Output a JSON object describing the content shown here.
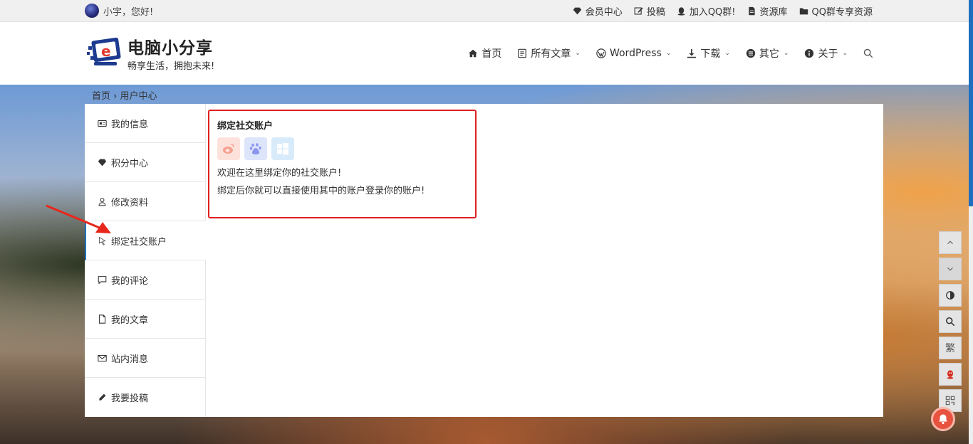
{
  "topbar": {
    "greeting": "小宇，您好!",
    "links": [
      {
        "label": "会员中心",
        "icon": "diamond-icon"
      },
      {
        "label": "投稿",
        "icon": "edit-icon"
      },
      {
        "label": "加入QQ群!",
        "icon": "qq-icon"
      },
      {
        "label": "资源库",
        "icon": "file-icon"
      },
      {
        "label": "QQ群专享资源",
        "icon": "folder-icon"
      }
    ]
  },
  "header": {
    "site_name": "电脑小分享",
    "slogan": "畅享生活，拥抱未来!",
    "nav": [
      {
        "label": "首页",
        "icon": "home-icon",
        "dropdown": false
      },
      {
        "label": "所有文章",
        "icon": "list-icon",
        "dropdown": true
      },
      {
        "label": "WordPress",
        "icon": "wordpress-icon",
        "dropdown": true
      },
      {
        "label": "下载",
        "icon": "download-icon",
        "dropdown": true
      },
      {
        "label": "其它",
        "icon": "circle-list-icon",
        "dropdown": true
      },
      {
        "label": "关于",
        "icon": "info-icon",
        "dropdown": true
      }
    ],
    "search_icon": "search-icon"
  },
  "breadcrumb": "首页 › 用户中心",
  "sidebar": {
    "items": [
      {
        "label": "我的信息",
        "icon": "id-card-icon",
        "active": false
      },
      {
        "label": "积分中心",
        "icon": "diamond-icon",
        "active": false
      },
      {
        "label": "修改资料",
        "icon": "user-icon",
        "active": false
      },
      {
        "label": "绑定社交账户",
        "icon": "pointer-icon",
        "active": true
      },
      {
        "label": "我的评论",
        "icon": "comment-icon",
        "active": false
      },
      {
        "label": "我的文章",
        "icon": "document-icon",
        "active": false
      },
      {
        "label": "站内消息",
        "icon": "mail-icon",
        "active": false
      },
      {
        "label": "我要投稿",
        "icon": "pencil-icon",
        "active": false
      }
    ]
  },
  "panel": {
    "title": "绑定社交账户",
    "socials": [
      {
        "name": "weibo",
        "icon": "weibo-icon"
      },
      {
        "name": "baidu",
        "icon": "baidu-icon"
      },
      {
        "name": "windows",
        "icon": "windows-icon"
      }
    ],
    "line1": "欢迎在这里绑定你的社交账户!",
    "line2": "绑定后你就可以直接使用其中的账户登录你的账户!"
  },
  "tools": {
    "traditional_label": "繁"
  },
  "colors": {
    "accent": "#1e73be",
    "highlight_border": "#e02020",
    "weibo": "#e6162d",
    "baidu": "#2932e1",
    "windows": "#00a4ef"
  }
}
